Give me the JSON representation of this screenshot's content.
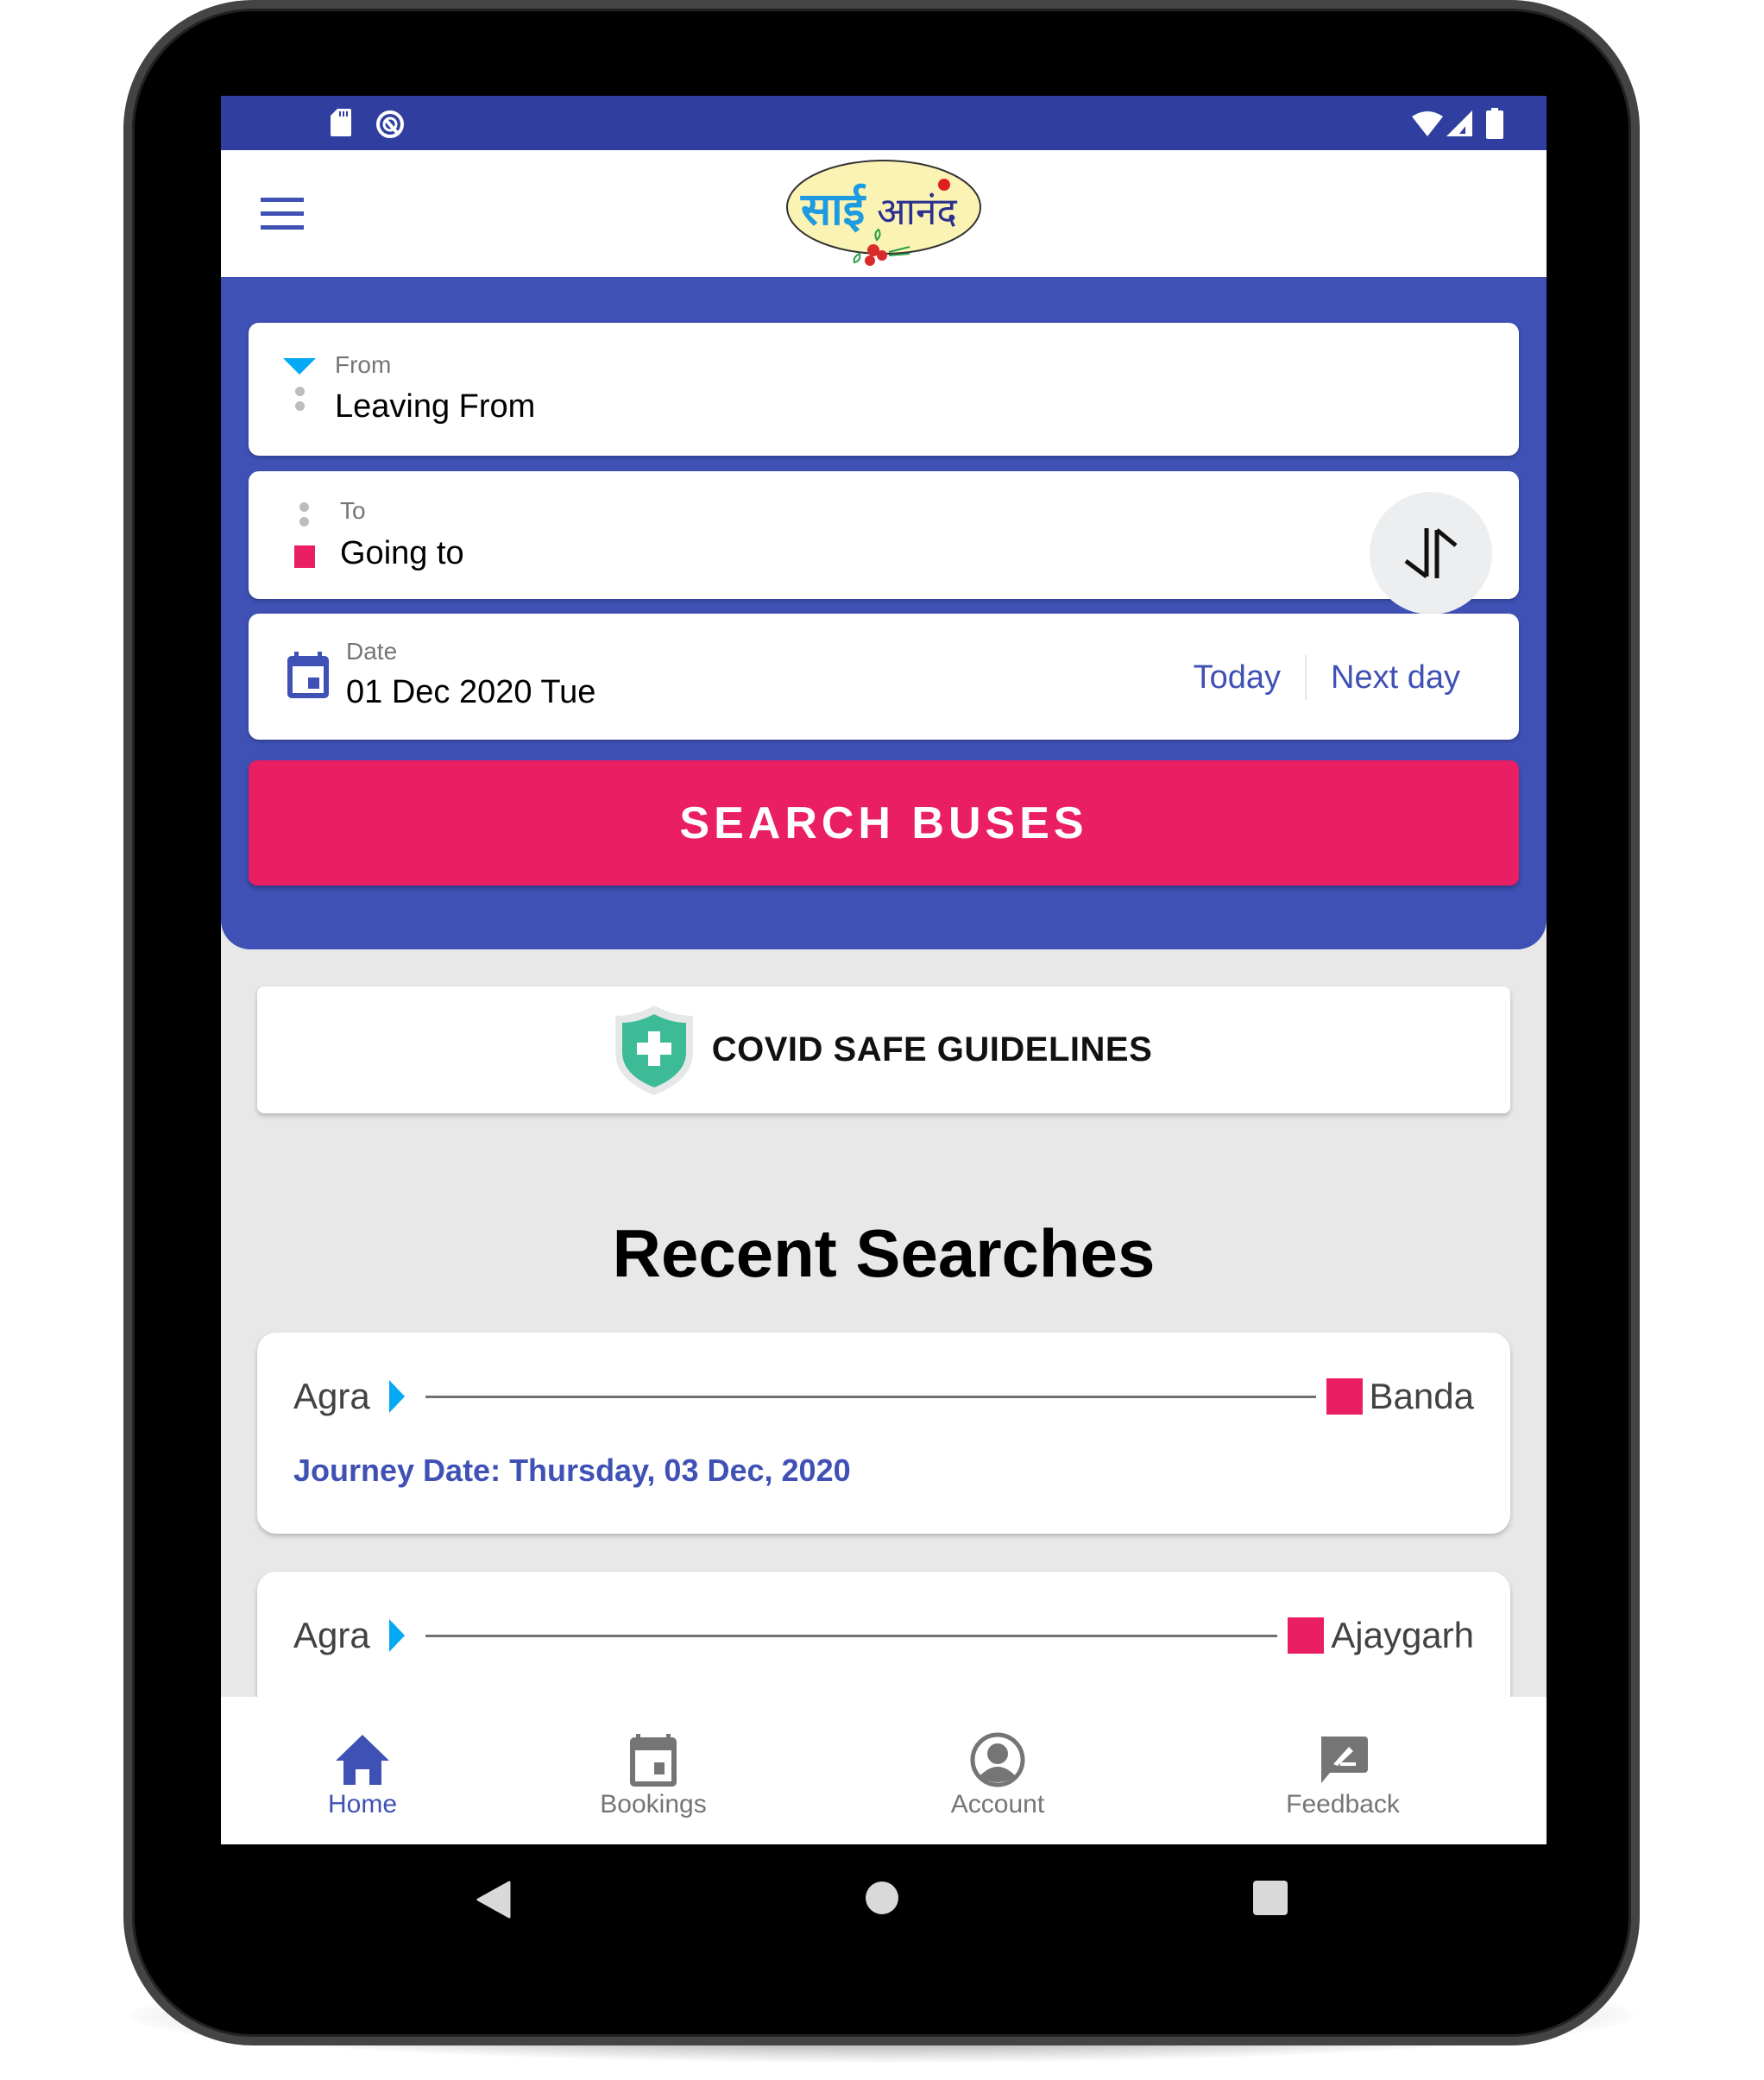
{
  "status_bar": {
    "left_icons": [
      "sd-card-icon",
      "sync-q-icon"
    ],
    "right_icons": [
      "wifi-icon",
      "cell-signal-icon",
      "battery-icon"
    ]
  },
  "app_bar": {
    "menu_icon": "hamburger-menu-icon",
    "logo_text": "साईआनंद"
  },
  "search_form": {
    "from": {
      "label": "From",
      "placeholder": "Leaving From"
    },
    "to": {
      "label": "To",
      "placeholder": "Going to"
    },
    "swap_icon": "swap-vertical-icon",
    "date": {
      "label": "Date",
      "value": "01 Dec 2020 Tue",
      "today_label": "Today",
      "next_day_label": "Next day"
    },
    "search_button_label": "SEARCH BUSES"
  },
  "covid": {
    "label": "COVID SAFE GUIDELINES",
    "icon": "shield-plus-icon"
  },
  "recent": {
    "title": "Recent Searches",
    "items": [
      {
        "from": "Agra",
        "to": "Banda",
        "journey_date": "Journey Date: Thursday, 03 Dec, 2020"
      },
      {
        "from": "Agra",
        "to": "Ajaygarh",
        "journey_date": ""
      }
    ]
  },
  "bottom_nav": {
    "items": [
      {
        "label": "Home",
        "icon": "home-icon",
        "active": true
      },
      {
        "label": "Bookings",
        "icon": "calendar-icon",
        "active": false
      },
      {
        "label": "Account",
        "icon": "account-circle-icon",
        "active": false
      },
      {
        "label": "Feedback",
        "icon": "feedback-icon",
        "active": false
      }
    ]
  },
  "colors": {
    "primary": "#3f51b5",
    "primary_dark": "#303f9f",
    "accent": "#e91e63",
    "from_marker": "#03a9f4",
    "covid_shield": "#3dbb97",
    "background": "#e8e8e8"
  },
  "system_nav": {
    "back": "back-icon",
    "home": "home-circle-icon",
    "recents": "recents-icon"
  }
}
